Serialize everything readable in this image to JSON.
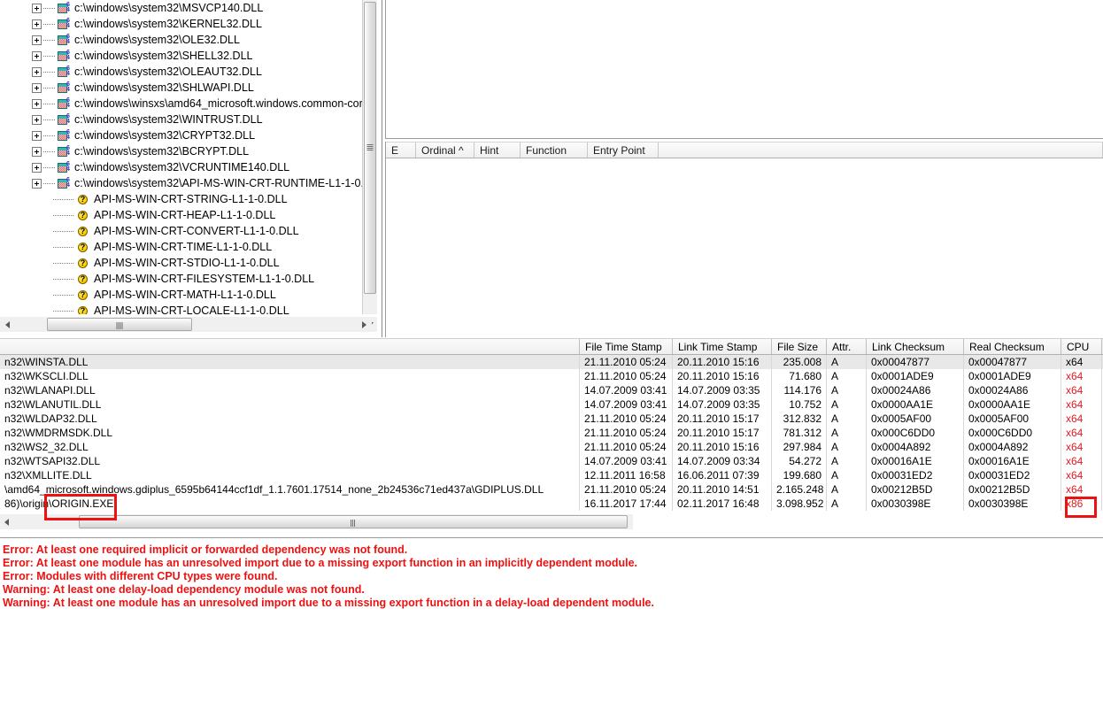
{
  "tree": {
    "items": [
      {
        "label": "c:\\windows\\system32\\MSVCP140.DLL",
        "icon": "module-64-icon",
        "expandable": true
      },
      {
        "label": "c:\\windows\\system32\\KERNEL32.DLL",
        "icon": "module-64-icon",
        "expandable": true
      },
      {
        "label": "c:\\windows\\system32\\OLE32.DLL",
        "icon": "module-64-icon",
        "expandable": true
      },
      {
        "label": "c:\\windows\\system32\\SHELL32.DLL",
        "icon": "module-64-icon",
        "expandable": true
      },
      {
        "label": "c:\\windows\\system32\\OLEAUT32.DLL",
        "icon": "module-64-icon",
        "expandable": true
      },
      {
        "label": "c:\\windows\\system32\\SHLWAPI.DLL",
        "icon": "module-64-icon",
        "expandable": true
      },
      {
        "label": "c:\\windows\\winsxs\\amd64_microsoft.windows.common-cor",
        "icon": "module-64-icon",
        "expandable": true
      },
      {
        "label": "c:\\windows\\system32\\WINTRUST.DLL",
        "icon": "module-64-icon",
        "expandable": true
      },
      {
        "label": "c:\\windows\\system32\\CRYPT32.DLL",
        "icon": "module-64-icon",
        "expandable": true
      },
      {
        "label": "c:\\windows\\system32\\BCRYPT.DLL",
        "icon": "module-64-icon",
        "expandable": true
      },
      {
        "label": "c:\\windows\\system32\\VCRUNTIME140.DLL",
        "icon": "module-64-icon",
        "expandable": true
      },
      {
        "label": "c:\\windows\\system32\\API-MS-WIN-CRT-RUNTIME-L1-1-0.D",
        "icon": "module-64-icon",
        "expandable": true
      },
      {
        "label": "API-MS-WIN-CRT-STRING-L1-1-0.DLL",
        "icon": "unknown-module-icon",
        "expandable": false
      },
      {
        "label": "API-MS-WIN-CRT-HEAP-L1-1-0.DLL",
        "icon": "unknown-module-icon",
        "expandable": false
      },
      {
        "label": "API-MS-WIN-CRT-CONVERT-L1-1-0.DLL",
        "icon": "unknown-module-icon",
        "expandable": false
      },
      {
        "label": "API-MS-WIN-CRT-TIME-L1-1-0.DLL",
        "icon": "unknown-module-icon",
        "expandable": false
      },
      {
        "label": "API-MS-WIN-CRT-STDIO-L1-1-0.DLL",
        "icon": "unknown-module-icon",
        "expandable": false
      },
      {
        "label": "API-MS-WIN-CRT-FILESYSTEM-L1-1-0.DLL",
        "icon": "unknown-module-icon",
        "expandable": false
      },
      {
        "label": "API-MS-WIN-CRT-MATH-L1-1-0.DLL",
        "icon": "unknown-module-icon",
        "expandable": false
      },
      {
        "label": "API-MS-WIN-CRT-LOCALE-L1-1-0.DLL",
        "icon": "unknown-module-icon",
        "expandable": false
      }
    ]
  },
  "exports": {
    "columns": [
      "E",
      "Ordinal ^",
      "Hint",
      "Function",
      "Entry Point"
    ],
    "rows": []
  },
  "modules": {
    "columns": [
      "File Time Stamp",
      "Link Time Stamp",
      "File Size",
      "Attr.",
      "Link Checksum",
      "Real Checksum",
      "CPU"
    ],
    "rows": [
      {
        "name": "n32\\WINSTA.DLL",
        "file_time": "21.11.2010 05:24",
        "link_time": "20.11.2010 15:16",
        "size": "235.008",
        "attr": "A",
        "link_checksum": "0x00047877",
        "real_checksum": "0x00047877",
        "cpu": "x64",
        "selected": true
      },
      {
        "name": "n32\\WKSCLI.DLL",
        "file_time": "21.11.2010 05:24",
        "link_time": "20.11.2010 15:16",
        "size": "71.680",
        "attr": "A",
        "link_checksum": "0x0001ADE9",
        "real_checksum": "0x0001ADE9",
        "cpu": "x64",
        "selected": false
      },
      {
        "name": "n32\\WLANAPI.DLL",
        "file_time": "14.07.2009 03:41",
        "link_time": "14.07.2009 03:35",
        "size": "114.176",
        "attr": "A",
        "link_checksum": "0x00024A86",
        "real_checksum": "0x00024A86",
        "cpu": "x64",
        "selected": false
      },
      {
        "name": "n32\\WLANUTIL.DLL",
        "file_time": "14.07.2009 03:41",
        "link_time": "14.07.2009 03:35",
        "size": "10.752",
        "attr": "A",
        "link_checksum": "0x0000AA1E",
        "real_checksum": "0x0000AA1E",
        "cpu": "x64",
        "selected": false
      },
      {
        "name": "n32\\WLDAP32.DLL",
        "file_time": "21.11.2010 05:24",
        "link_time": "20.11.2010 15:17",
        "size": "312.832",
        "attr": "A",
        "link_checksum": "0x0005AF00",
        "real_checksum": "0x0005AF00",
        "cpu": "x64",
        "selected": false
      },
      {
        "name": "n32\\WMDRMSDK.DLL",
        "file_time": "21.11.2010 05:24",
        "link_time": "20.11.2010 15:17",
        "size": "781.312",
        "attr": "A",
        "link_checksum": "0x000C6DD0",
        "real_checksum": "0x000C6DD0",
        "cpu": "x64",
        "selected": false
      },
      {
        "name": "n32\\WS2_32.DLL",
        "file_time": "21.11.2010 05:24",
        "link_time": "20.11.2010 15:16",
        "size": "297.984",
        "attr": "A",
        "link_checksum": "0x0004A892",
        "real_checksum": "0x0004A892",
        "cpu": "x64",
        "selected": false
      },
      {
        "name": "n32\\WTSAPI32.DLL",
        "file_time": "14.07.2009 03:41",
        "link_time": "14.07.2009 03:34",
        "size": "54.272",
        "attr": "A",
        "link_checksum": "0x00016A1E",
        "real_checksum": "0x00016A1E",
        "cpu": "x64",
        "selected": false
      },
      {
        "name": "n32\\XMLLITE.DLL",
        "file_time": "12.11.2011 16:58",
        "link_time": "16.06.2011 07:39",
        "size": "199.680",
        "attr": "A",
        "link_checksum": "0x00031ED2",
        "real_checksum": "0x00031ED2",
        "cpu": "x64",
        "selected": false
      },
      {
        "name": "\\amd64_microsoft.windows.gdiplus_6595b64144ccf1df_1.1.7601.17514_none_2b24536c71ed437a\\GDIPLUS.DLL",
        "file_time": "21.11.2010 05:24",
        "link_time": "20.11.2010 14:51",
        "size": "2.165.248",
        "attr": "A",
        "link_checksum": "0x00212B5D",
        "real_checksum": "0x00212B5D",
        "cpu": "x64",
        "selected": false
      },
      {
        "name": "86)\\origin\\ORIGIN.EXE",
        "file_time": "16.11.2017 17:44",
        "link_time": "02.11.2017 16:48",
        "size": "3.098.952",
        "attr": "A",
        "link_checksum": "0x0030398E",
        "real_checksum": "0x0030398E",
        "cpu": "x86",
        "selected": false
      }
    ]
  },
  "log": {
    "lines": [
      "Error: At least one required implicit or forwarded dependency was not found.",
      "Error: At least one module has an unresolved import due to a missing export function in an implicitly dependent module.",
      "Error: Modules with different CPU types were found.",
      "Warning: At least one delay-load dependency module was not found.",
      "Warning: At least one module has an unresolved import due to a missing export function in a delay-load dependent module."
    ]
  },
  "annotations": {
    "highlight_color": "#ee1111",
    "boxes": [
      {
        "name": "origin-exe-highlight",
        "label": "ORIGIN.EXE"
      },
      {
        "name": "cpu-x86-highlight",
        "label": "x86"
      }
    ]
  },
  "colors": {
    "error_text": "#ee1111",
    "cpu_mismatch": "#e01b1b",
    "selected_row": "#e8e8e8"
  }
}
